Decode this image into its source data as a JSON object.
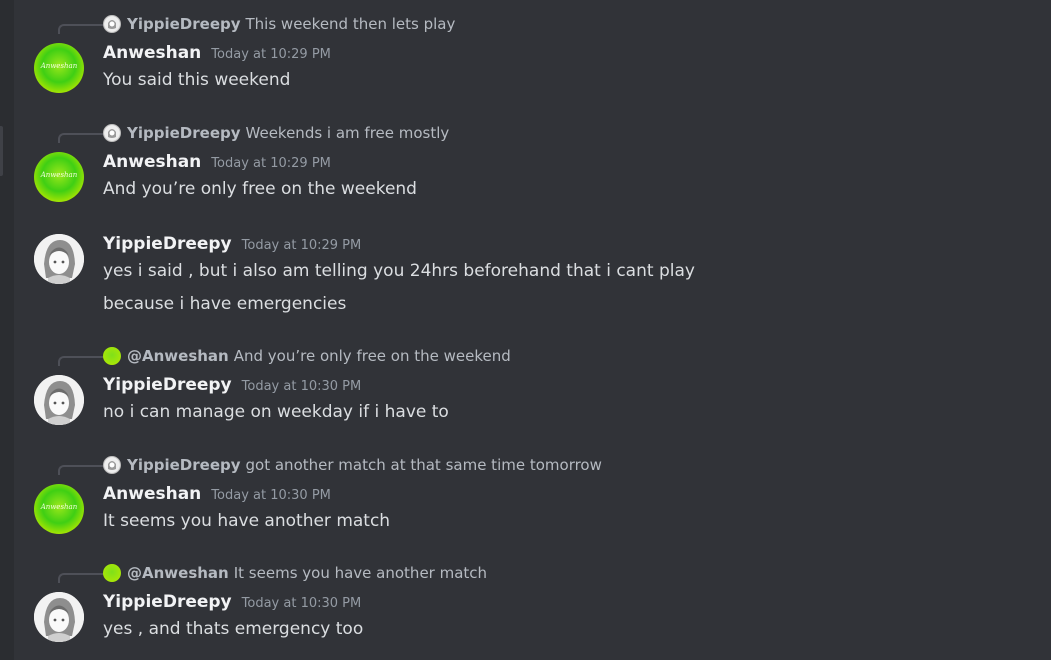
{
  "messages": [
    {
      "author": "Anweshan",
      "avatar": "green-signature-avatar",
      "avatar_text": "Anweshan",
      "time": "Today at 10:29 PM",
      "reply": {
        "name": "YippieDreepy",
        "text": "This weekend then lets play",
        "avatar": "sketch-avatar"
      },
      "lines": [
        "You said this weekend"
      ]
    },
    {
      "author": "Anweshan",
      "avatar": "green-signature-avatar",
      "avatar_text": "Anweshan",
      "time": "Today at 10:29 PM",
      "reply": {
        "name": "YippieDreepy",
        "text": "Weekends i am free mostly",
        "avatar": "sketch-avatar"
      },
      "lines": [
        "And you’re only free on the weekend"
      ]
    },
    {
      "author": "YippieDreepy",
      "avatar": "sketch-avatar",
      "time": "Today at 10:29 PM",
      "lines": [
        "yes i said , but i also am telling you 24hrs beforehand that i cant play",
        "because i have emergencies"
      ]
    },
    {
      "author": "YippieDreepy",
      "avatar": "sketch-avatar",
      "time": "Today at 10:30 PM",
      "reply": {
        "name": "@Anweshan",
        "text": "And you’re only free on the weekend",
        "avatar": "green-signature-avatar"
      },
      "lines": [
        "no i can manage on weekday if i have to"
      ]
    },
    {
      "author": "Anweshan",
      "avatar": "green-signature-avatar",
      "avatar_text": "Anweshan",
      "time": "Today at 10:30 PM",
      "reply": {
        "name": "YippieDreepy",
        "text": "got another match at that same time tomorrow",
        "avatar": "sketch-avatar"
      },
      "lines": [
        "It seems you have another match"
      ]
    },
    {
      "author": "YippieDreepy",
      "avatar": "sketch-avatar",
      "time": "Today at 10:30 PM",
      "reply": {
        "name": "@Anweshan",
        "text": "It seems you have another match",
        "avatar": "green-signature-avatar"
      },
      "lines": [
        "yes , and thats emergency too"
      ]
    }
  ]
}
